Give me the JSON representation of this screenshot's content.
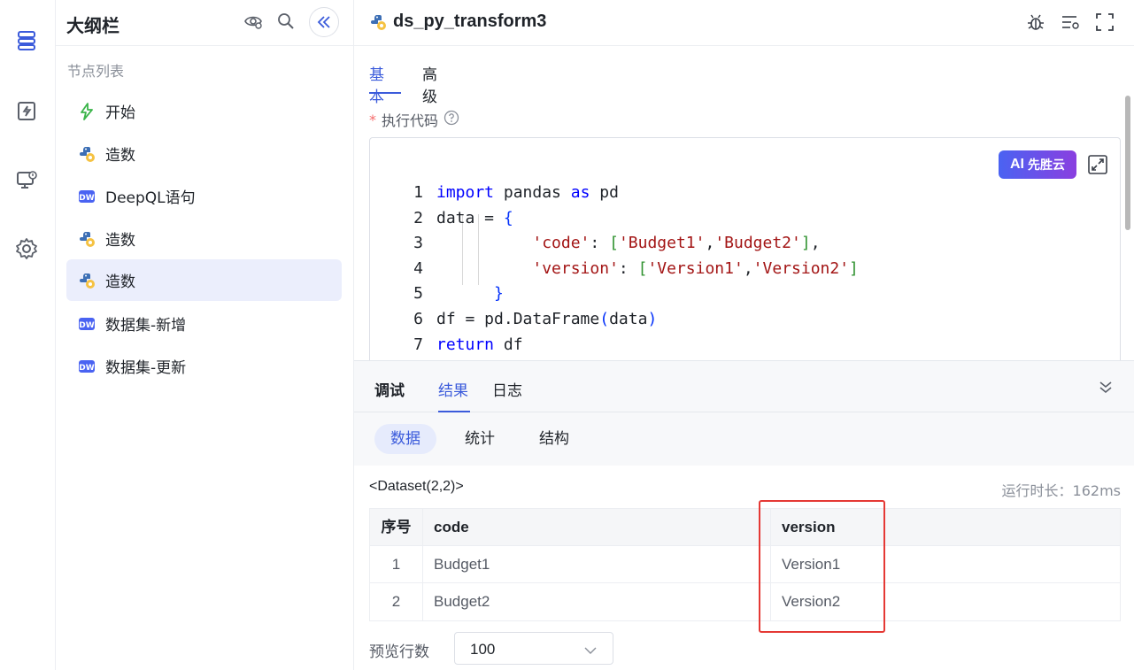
{
  "outline": {
    "title": "大纲栏",
    "list_caption": "节点列表",
    "nodes": [
      {
        "label": "开始",
        "icon": "lightning-icon"
      },
      {
        "label": "造数",
        "icon": "python-icon"
      },
      {
        "label": "DeepQL语句",
        "icon": "dw-icon"
      },
      {
        "label": "造数",
        "icon": "python-icon"
      },
      {
        "label": "造数",
        "icon": "python-icon",
        "active": true
      },
      {
        "label": "数据集-新增",
        "icon": "dw-icon"
      },
      {
        "label": "数据集-更新",
        "icon": "dw-icon"
      }
    ]
  },
  "main": {
    "title": "ds_py_transform3",
    "tabs": [
      "基本",
      "高级"
    ],
    "active_tab": "基本",
    "field_label": "执行代码",
    "required_mark": "*",
    "ai_button": {
      "ai": "AI",
      "label": "先胜云"
    },
    "code_lines": [
      {
        "n": "1"
      },
      {
        "n": "2"
      },
      {
        "n": "3"
      },
      {
        "n": "4"
      },
      {
        "n": "5"
      },
      {
        "n": "6"
      },
      {
        "n": "7"
      }
    ]
  },
  "debug": {
    "tabs": [
      "调试",
      "结果",
      "日志"
    ],
    "active_tab": "结果",
    "subtabs": [
      "数据",
      "统计",
      "结构"
    ],
    "active_subtab": "数据",
    "dataset_title": "<Dataset(2,2)>",
    "runtime": "运行时长：162ms",
    "table": {
      "columns": [
        "序号",
        "code",
        "version"
      ],
      "rows": [
        [
          "1",
          "Budget1",
          "Version1"
        ],
        [
          "2",
          "Budget2",
          "Version2"
        ]
      ]
    },
    "preview_label": "预览行数",
    "preview_value": "100"
  },
  "colors": {
    "accent": "#3b5bdb",
    "highlight": "#e53935"
  }
}
